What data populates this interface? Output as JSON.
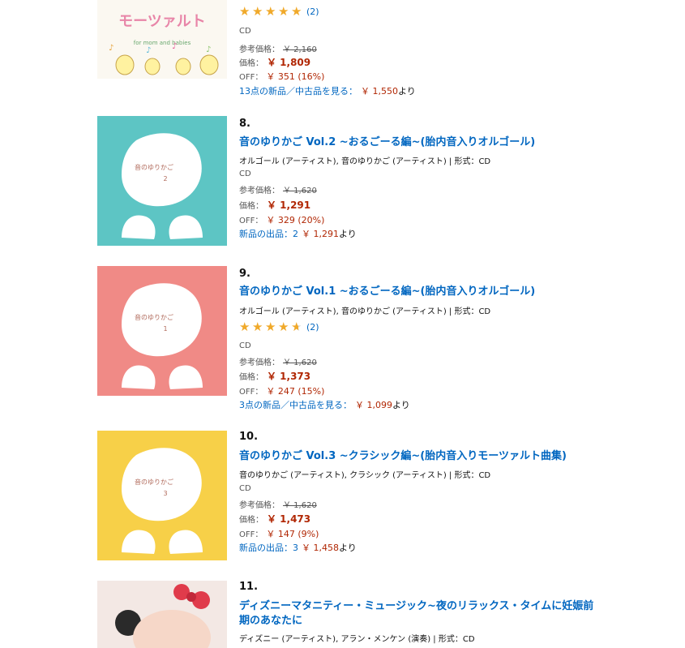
{
  "items": [
    {
      "rank": "",
      "title": "",
      "cover_text": "モーツァルト",
      "cover_subtext": "for mom and babies",
      "stars": 5,
      "reviews": "(2)",
      "format": "CD",
      "list_label": "参考価格：",
      "list_price": "￥ 2,160",
      "price_label": "価格：",
      "price": "￥ 1,809",
      "off_label": "OFF：",
      "off": "￥ 351 (16%)",
      "offers_text": "13点の新品／中古品を見る：",
      "offers_price": "￥ 1,550",
      "offers_suffix": "より"
    },
    {
      "rank": "8.",
      "title": "音のゆりかご Vol.2 ~おるごーる編~(胎内音入りオルゴール)",
      "byline": "オルゴール (アーティスト), 音のゆりかご (アーティスト) | 形式：CD",
      "cover_text": "音のゆりかご",
      "cover_num": "2",
      "format": "CD",
      "list_label": "参考価格：",
      "list_price": "￥ 1,620",
      "price_label": "価格：",
      "price": "￥ 1,291",
      "off_label": "OFF：",
      "off": "￥ 329 (20%)",
      "offers_text": "新品の出品：2",
      "offers_price": "￥ 1,291",
      "offers_suffix": "より"
    },
    {
      "rank": "9.",
      "title": "音のゆりかご Vol.1 ~おるごーる編~(胎内音入りオルゴール)",
      "byline": "オルゴール (アーティスト), 音のゆりかご (アーティスト) | 形式：CD",
      "cover_text": "音のゆりかご",
      "cover_num": "1",
      "stars": 4.5,
      "reviews": "(2)",
      "format": "CD",
      "list_label": "参考価格：",
      "list_price": "￥ 1,620",
      "price_label": "価格：",
      "price": "￥ 1,373",
      "off_label": "OFF：",
      "off": "￥ 247 (15%)",
      "offers_text": "3点の新品／中古品を見る：",
      "offers_price": "￥ 1,099",
      "offers_suffix": "より"
    },
    {
      "rank": "10.",
      "title": "音のゆりかご Vol.3 ~クラシック編~(胎内音入りモーツァルト曲集)",
      "byline": "音のゆりかご (アーティスト), クラシック (アーティスト) | 形式：CD",
      "cover_text": "音のゆりかご",
      "cover_num": "3",
      "format": "CD",
      "list_label": "参考価格：",
      "list_price": "￥ 1,620",
      "price_label": "価格：",
      "price": "￥ 1,473",
      "off_label": "OFF：",
      "off": "￥ 147 (9%)",
      "offers_text": "新品の出品：3",
      "offers_price": "￥ 1,458",
      "offers_suffix": "より"
    },
    {
      "rank": "11.",
      "title_line1": "ディズニーマタニティー・ミュージック~夜のリラックス・タイムに妊娠前",
      "title_line2": "期のあなたに",
      "byline": "ディズニー (アーティスト), アラン・メンケン (演奏) | 形式：CD"
    }
  ],
  "colors": {
    "link": "#0066c0",
    "price": "#b12704",
    "star": "#f0a92a",
    "cover2": "#5dc5c4",
    "cover1": "#f08a86",
    "cover3": "#f7d048"
  }
}
